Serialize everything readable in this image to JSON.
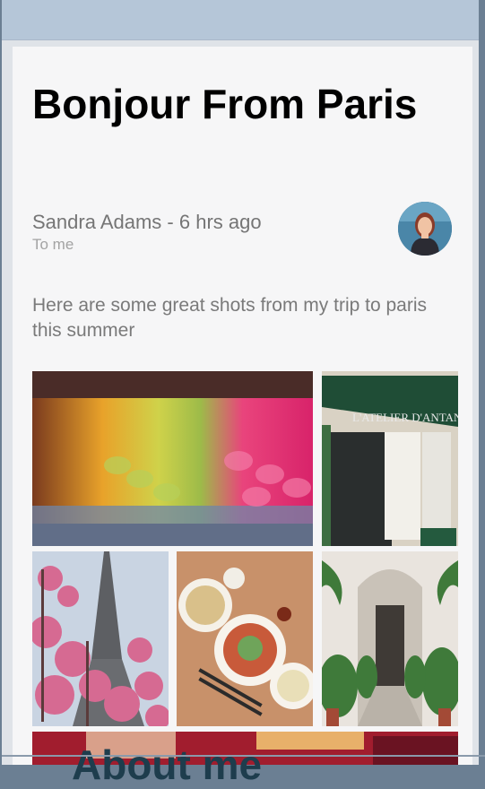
{
  "email": {
    "title": "Bonjour From Paris",
    "sender_line": "Sandra Adams - 6 hrs ago",
    "recipient": "To me",
    "body": "Here are some great shots from my trip to paris this summer"
  },
  "footer": {
    "heading": "About me"
  },
  "colors": {
    "topbar": "#b5c6d8",
    "card": "#f6f6f7",
    "title_text": "#000000",
    "meta_text": "#757575"
  }
}
